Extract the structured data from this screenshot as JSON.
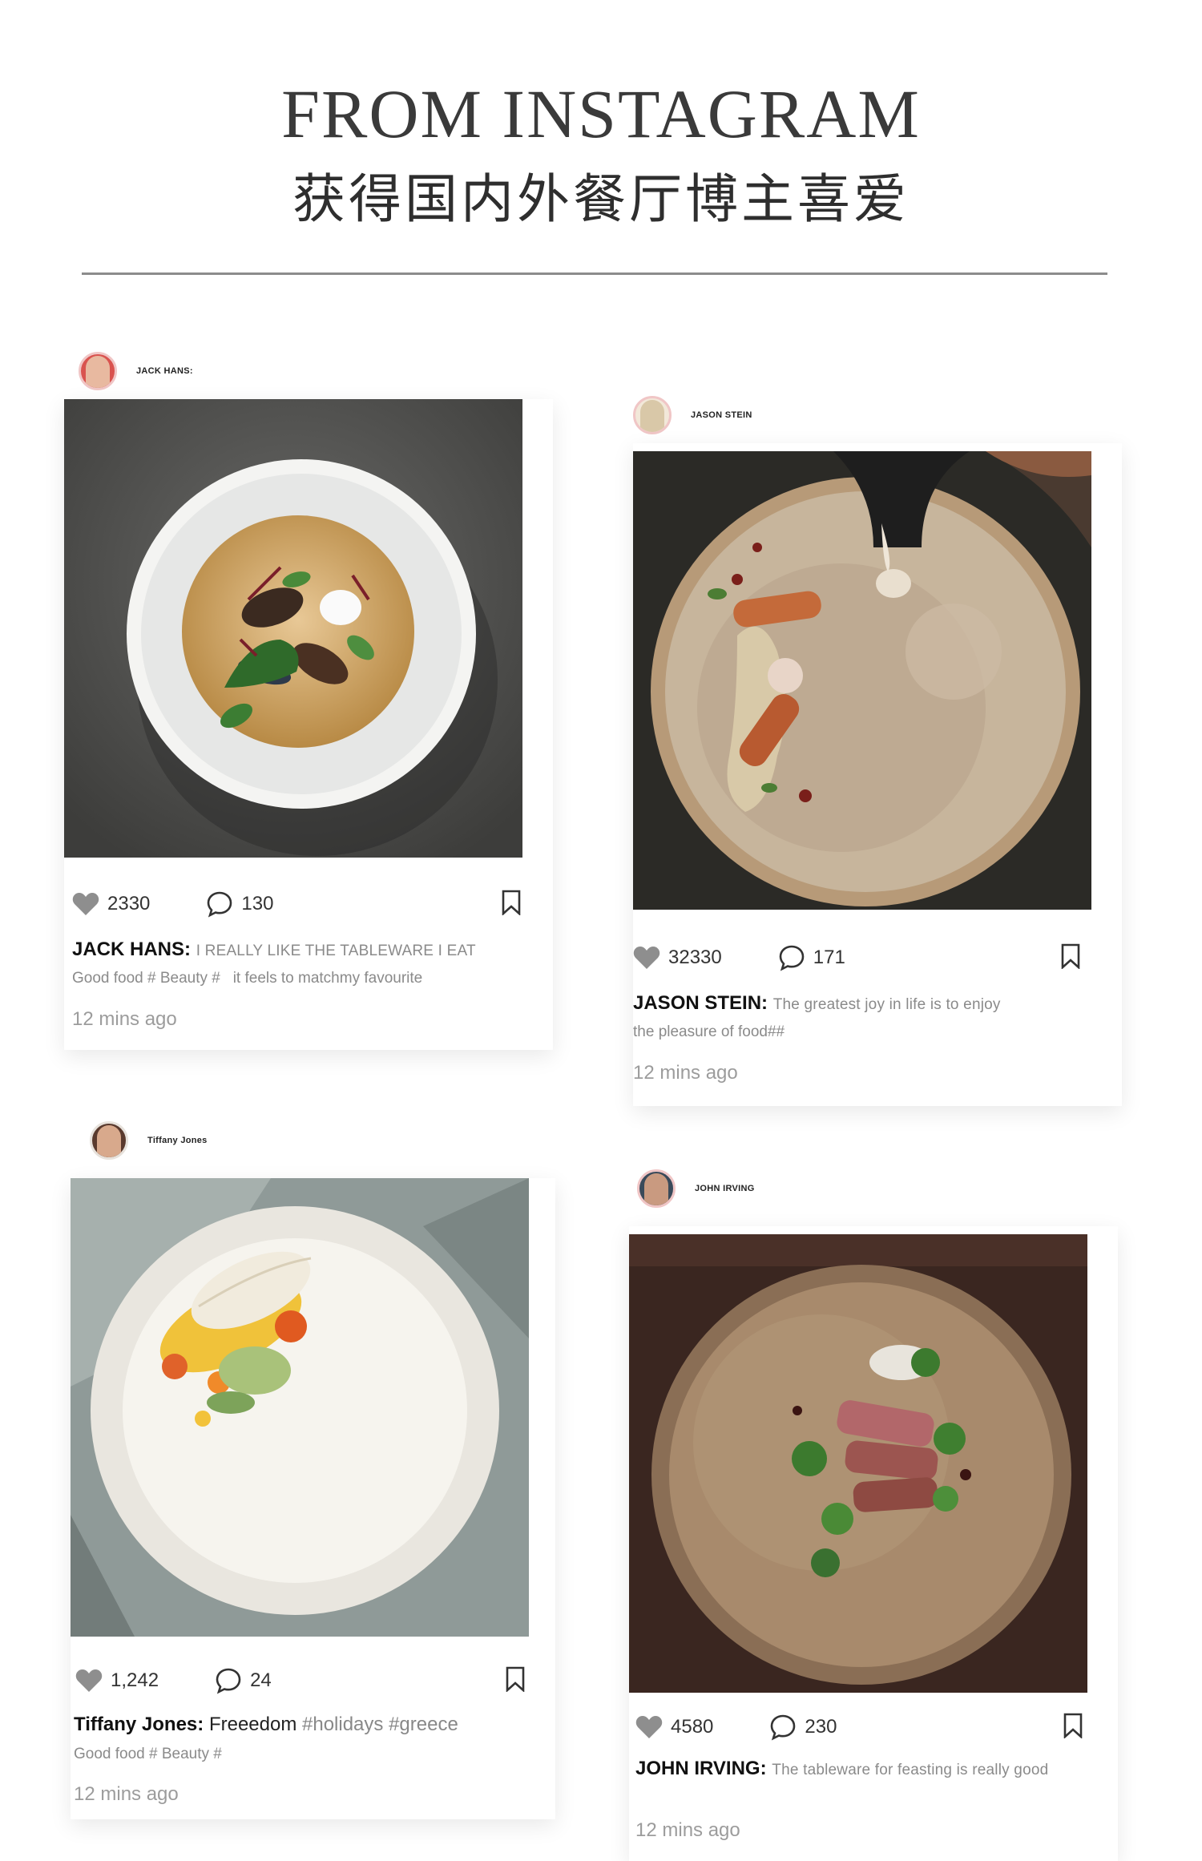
{
  "header": {
    "title": "FROM INSTAGRAM",
    "subtitle": "获得国内外餐厅博主喜爱"
  },
  "posts": [
    {
      "username": "JACK HANS:",
      "likes": "2330",
      "comments": "130",
      "author": "JACK HANS:",
      "caption": "I REALLY LIKE THE TABLEWARE I EAT",
      "caption_line2": "Good food # Beauty #   it feels to matchmy favourite",
      "time": "12 mins ago"
    },
    {
      "username": "JASON STEIN",
      "likes": "32330",
      "comments": "171",
      "author": "JASON STEIN:",
      "caption": "The greatest joy in life is to enjoy",
      "caption_line2": "the pleasure of food##",
      "time": "12 mins ago"
    },
    {
      "username": "Tiffany Jones",
      "likes": "1,242",
      "comments": "24",
      "author": "Tiffany Jones:",
      "caption": "Freeedom",
      "hashtags": "#holidays #greece",
      "caption_line2": "Good food # Beauty #",
      "time": "12 mins ago"
    },
    {
      "username": "JOHN IRVING",
      "likes": "4580",
      "comments": "230",
      "author": "JOHN IRVING:",
      "caption": "The tableware for feasting is really good",
      "time": "12 mins ago"
    }
  ],
  "icons": {
    "like": "heart-icon",
    "comment": "comment-bubble-icon",
    "save": "bookmark-icon"
  },
  "colors": {
    "heart": "#8e8e8e",
    "divider": "#8c8c8c",
    "meta_text": "#9c9c9c"
  }
}
